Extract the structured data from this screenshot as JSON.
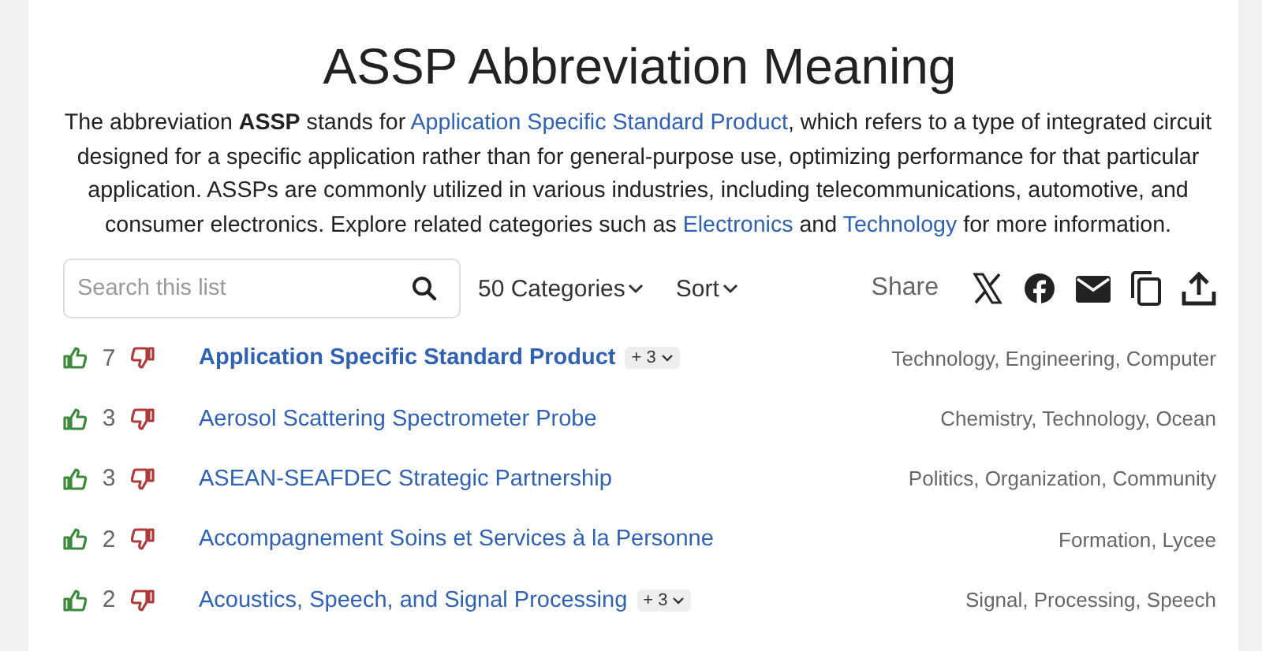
{
  "title": "ASSP Abbreviation Meaning",
  "description": [
    {
      "kind": "plain",
      "text": "The abbreviation "
    },
    {
      "kind": "bold",
      "text": "ASSP"
    },
    {
      "kind": "plain",
      "text": " stands for "
    },
    {
      "kind": "link",
      "text": "Application Specific Standard Product"
    },
    {
      "kind": "plain",
      "text": ", which refers to a type of integrated circuit designed for a specific application rather than for general-purpose use, optimizing performance for that particular application. ASSPs are commonly utilized in various industries, including telecommunications, automotive, and consumer electronics. Explore related categories such as "
    },
    {
      "kind": "link",
      "text": "Electronics"
    },
    {
      "kind": "plain",
      "text": " and "
    },
    {
      "kind": "link",
      "text": "Technology"
    },
    {
      "kind": "plain",
      "text": " for more information."
    }
  ],
  "search": {
    "placeholder": "Search this list"
  },
  "filters": [
    {
      "label": "50 Categories"
    },
    {
      "label": "Sort"
    }
  ],
  "share": {
    "label": "Share"
  },
  "rows": [
    {
      "votes": "7",
      "term": "Application Specific Standard Product",
      "selected": true,
      "more": "+ 3",
      "categories": "Technology, Engineering, Computer"
    },
    {
      "votes": "3",
      "term": "Aerosol Scattering Spectrometer Probe",
      "selected": false,
      "categories": "Chemistry, Technology, Ocean"
    },
    {
      "votes": "3",
      "term": "ASEAN-SEAFDEC Strategic Partnership",
      "selected": false,
      "categories": "Politics, Organization, Community"
    },
    {
      "votes": "2",
      "term": "Accompagnement Soins et Services à la Personne",
      "selected": false,
      "categories": "Formation, Lycee"
    },
    {
      "votes": "2",
      "term": "Acoustics, Speech, and Signal Processing",
      "selected": false,
      "more": "+ 3",
      "categories": "Signal, Processing, Speech"
    }
  ]
}
